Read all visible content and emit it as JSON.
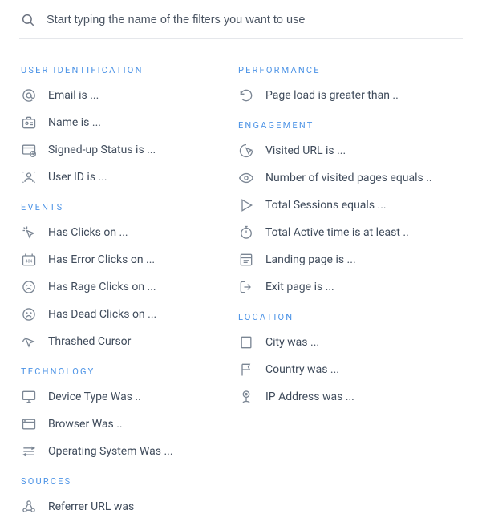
{
  "search": {
    "placeholder": "Start typing the name of the filters you want to use"
  },
  "left": {
    "user_identification": {
      "header": "USER IDENTIFICATION",
      "email": "Email is ...",
      "name": "Name is ...",
      "signup": "Signed-up Status is ...",
      "userid": "User ID is ..."
    },
    "events": {
      "header": "EVENTS",
      "clicks": "Has Clicks on ...",
      "error_clicks": "Has Error Clicks on ...",
      "rage_clicks": "Has Rage Clicks on ...",
      "dead_clicks": "Has Dead Clicks on ...",
      "thrashed": "Thrashed Cursor"
    },
    "technology": {
      "header": "TECHNOLOGY",
      "device": "Device Type Was ..",
      "browser": "Browser Was ..",
      "os": "Operating System Was ..."
    },
    "sources": {
      "header": "SOURCES",
      "referrer": "Referrer URL was"
    }
  },
  "right": {
    "performance": {
      "header": "PERFORMANCE",
      "page_load": "Page load is greater than .."
    },
    "engagement": {
      "header": "ENGAGEMENT",
      "visited_url": "Visited URL is ...",
      "visited_pages": "Number of visited pages equals ..",
      "total_sessions": "Total Sessions equals ...",
      "active_time": "Total Active time is at least ..",
      "landing": "Landing page is ...",
      "exit": "Exit page is ..."
    },
    "location": {
      "header": "LOCATION",
      "city": "City was ...",
      "country": "Country was ...",
      "ip": "IP Address was ..."
    }
  }
}
